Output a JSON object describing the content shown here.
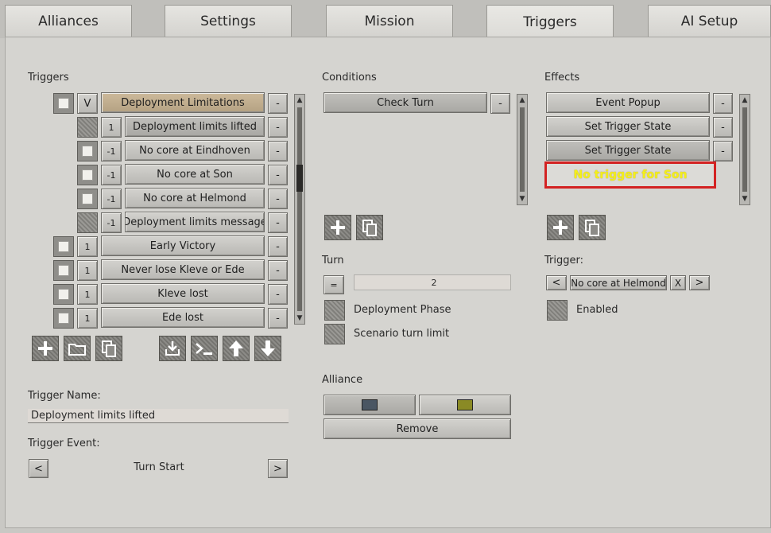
{
  "tabs": [
    {
      "label": "Alliances"
    },
    {
      "label": "Settings"
    },
    {
      "label": "Mission"
    },
    {
      "label": "Triggers"
    },
    {
      "label": "AI Setup"
    }
  ],
  "active_tab": "Triggers",
  "triggers": {
    "title": "Triggers",
    "parent": {
      "check_label": "V",
      "label": "Deployment Limitations",
      "remove": "-"
    },
    "children": [
      {
        "num": "1",
        "label": "Deployment limits lifted",
        "remove": "-"
      },
      {
        "num": "-1",
        "label": "No core at Eindhoven",
        "remove": "-"
      },
      {
        "num": "-1",
        "label": "No core at Son",
        "remove": "-"
      },
      {
        "num": "-1",
        "label": "No core at Helmond",
        "remove": "-"
      },
      {
        "num": "-1",
        "label": "Deployment limits message",
        "remove": "-"
      }
    ],
    "top": [
      {
        "num": "1",
        "label": "Early Victory",
        "remove": "-"
      },
      {
        "num": "1",
        "label": "Never lose Kleve or Ede",
        "remove": "-"
      },
      {
        "num": "1",
        "label": "Kleve lost",
        "remove": "-"
      },
      {
        "num": "1",
        "label": "Ede lost",
        "remove": "-"
      }
    ],
    "name_label": "Trigger Name:",
    "name_value": "Deployment limits lifted",
    "event_label": "Trigger Event:",
    "event_value": "Turn Start",
    "prev": "<",
    "next": ">"
  },
  "conditions": {
    "title": "Conditions",
    "items": [
      {
        "label": "Check Turn",
        "remove": "-"
      }
    ],
    "turn_label": "Turn",
    "turn_op": "=",
    "turn_value": "2",
    "options": [
      {
        "label": "Deployment Phase"
      },
      {
        "label": "Scenario turn limit"
      }
    ],
    "alliance_label": "Alliance",
    "alliance_colors": [
      "#4a5663",
      "#8a8a25"
    ],
    "remove_label": "Remove"
  },
  "effects": {
    "title": "Effects",
    "items": [
      {
        "label": "Event Popup",
        "remove": "-"
      },
      {
        "label": "Set Trigger State",
        "remove": "-"
      },
      {
        "label": "Set Trigger State",
        "remove": "-"
      }
    ],
    "highlight_text": "No trigger for Son",
    "trigger_label": "Trigger:",
    "trigger_prev": "<",
    "trigger_value": "No core at Helmond",
    "trigger_clear": "X",
    "trigger_next": ">",
    "enabled_label": "Enabled"
  },
  "scroll_arrows": {
    "up": "▲",
    "down": "▼"
  }
}
